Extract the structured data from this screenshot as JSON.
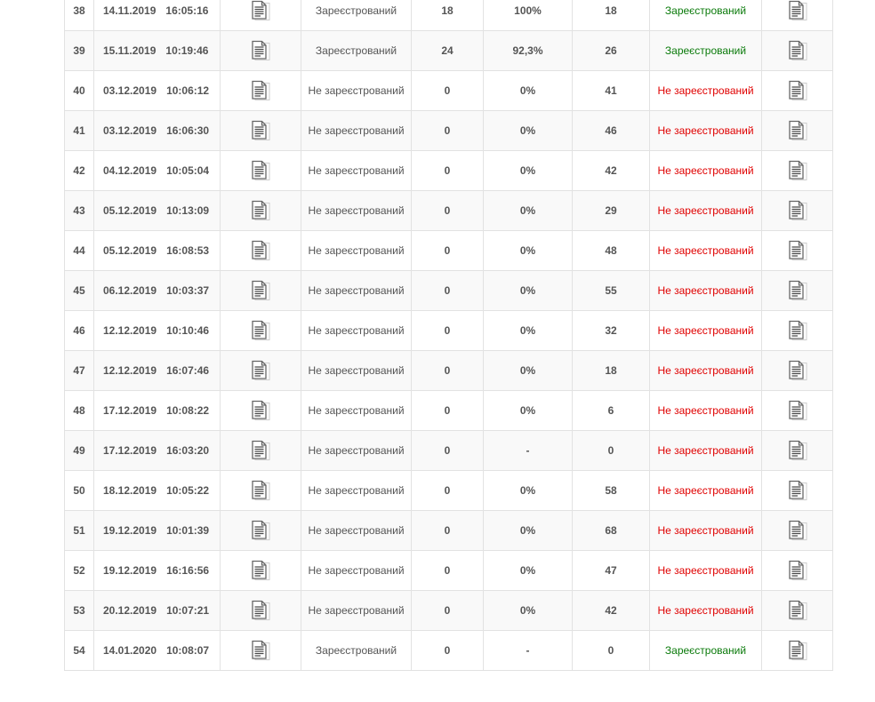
{
  "colors": {
    "registered": "#0a7a0a",
    "not_registered": "#e00000",
    "text": "#555555",
    "border": "#e2e2e2",
    "row_alt": "#f9f9f9"
  },
  "icons": {
    "document": "document-icon"
  },
  "rows": [
    {
      "num": "38",
      "date": "14.11.2019",
      "time": "16:05:16",
      "status": "Зареєстрований",
      "count": "18",
      "percent": "100%",
      "total": "18",
      "result": "Зареєстрований",
      "result_ok": true
    },
    {
      "num": "39",
      "date": "15.11.2019",
      "time": "10:19:46",
      "status": "Зареєстрований",
      "count": "24",
      "percent": "92,3%",
      "total": "26",
      "result": "Зареєстрований",
      "result_ok": true
    },
    {
      "num": "40",
      "date": "03.12.2019",
      "time": "10:06:12",
      "status": "Не зареєстрований",
      "count": "0",
      "percent": "0%",
      "total": "41",
      "result": "Не зареєстрований",
      "result_ok": false
    },
    {
      "num": "41",
      "date": "03.12.2019",
      "time": "16:06:30",
      "status": "Не зареєстрований",
      "count": "0",
      "percent": "0%",
      "total": "46",
      "result": "Не зареєстрований",
      "result_ok": false
    },
    {
      "num": "42",
      "date": "04.12.2019",
      "time": "10:05:04",
      "status": "Не зареєстрований",
      "count": "0",
      "percent": "0%",
      "total": "42",
      "result": "Не зареєстрований",
      "result_ok": false
    },
    {
      "num": "43",
      "date": "05.12.2019",
      "time": "10:13:09",
      "status": "Не зареєстрований",
      "count": "0",
      "percent": "0%",
      "total": "29",
      "result": "Не зареєстрований",
      "result_ok": false
    },
    {
      "num": "44",
      "date": "05.12.2019",
      "time": "16:08:53",
      "status": "Не зареєстрований",
      "count": "0",
      "percent": "0%",
      "total": "48",
      "result": "Не зареєстрований",
      "result_ok": false
    },
    {
      "num": "45",
      "date": "06.12.2019",
      "time": "10:03:37",
      "status": "Не зареєстрований",
      "count": "0",
      "percent": "0%",
      "total": "55",
      "result": "Не зареєстрований",
      "result_ok": false
    },
    {
      "num": "46",
      "date": "12.12.2019",
      "time": "10:10:46",
      "status": "Не зареєстрований",
      "count": "0",
      "percent": "0%",
      "total": "32",
      "result": "Не зареєстрований",
      "result_ok": false
    },
    {
      "num": "47",
      "date": "12.12.2019",
      "time": "16:07:46",
      "status": "Не зареєстрований",
      "count": "0",
      "percent": "0%",
      "total": "18",
      "result": "Не зареєстрований",
      "result_ok": false
    },
    {
      "num": "48",
      "date": "17.12.2019",
      "time": "10:08:22",
      "status": "Не зареєстрований",
      "count": "0",
      "percent": "0%",
      "total": "6",
      "result": "Не зареєстрований",
      "result_ok": false
    },
    {
      "num": "49",
      "date": "17.12.2019",
      "time": "16:03:20",
      "status": "Не зареєстрований",
      "count": "0",
      "percent": "-",
      "total": "0",
      "result": "Не зареєстрований",
      "result_ok": false
    },
    {
      "num": "50",
      "date": "18.12.2019",
      "time": "10:05:22",
      "status": "Не зареєстрований",
      "count": "0",
      "percent": "0%",
      "total": "58",
      "result": "Не зареєстрований",
      "result_ok": false
    },
    {
      "num": "51",
      "date": "19.12.2019",
      "time": "10:01:39",
      "status": "Не зареєстрований",
      "count": "0",
      "percent": "0%",
      "total": "68",
      "result": "Не зареєстрований",
      "result_ok": false
    },
    {
      "num": "52",
      "date": "19.12.2019",
      "time": "16:16:56",
      "status": "Не зареєстрований",
      "count": "0",
      "percent": "0%",
      "total": "47",
      "result": "Не зареєстрований",
      "result_ok": false
    },
    {
      "num": "53",
      "date": "20.12.2019",
      "time": "10:07:21",
      "status": "Не зареєстрований",
      "count": "0",
      "percent": "0%",
      "total": "42",
      "result": "Не зареєстрований",
      "result_ok": false
    },
    {
      "num": "54",
      "date": "14.01.2020",
      "time": "10:08:07",
      "status": "Зареєстрований",
      "count": "0",
      "percent": "-",
      "total": "0",
      "result": "Зареєстрований",
      "result_ok": true
    }
  ]
}
